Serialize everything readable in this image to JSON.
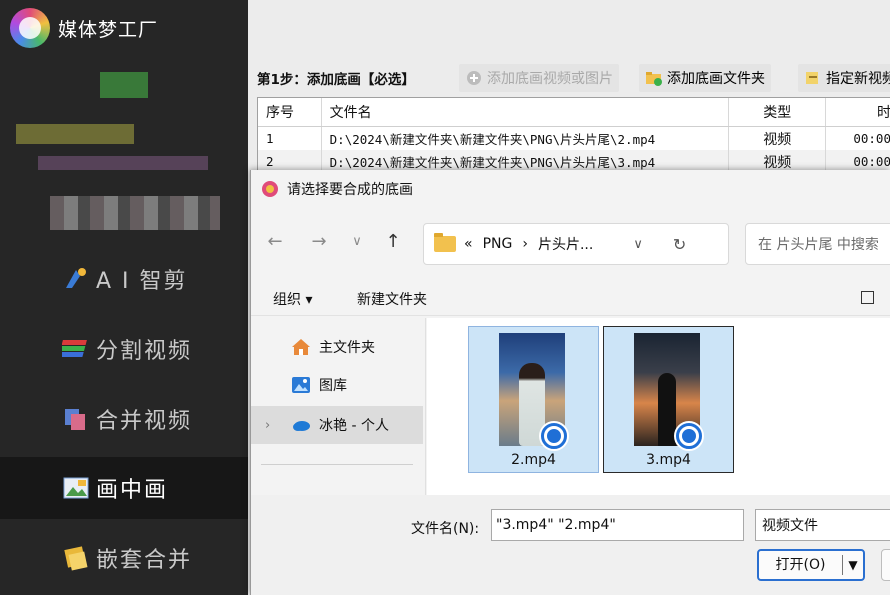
{
  "app": {
    "title": "媒体梦工厂"
  },
  "sidebar": {
    "items": [
      {
        "label": "A I 智剪",
        "icon": "ai-cut-icon"
      },
      {
        "label": "分割视频",
        "icon": "split-video-icon"
      },
      {
        "label": "合并视频",
        "icon": "merge-video-icon"
      },
      {
        "label": "画中画",
        "icon": "picture-in-picture-icon",
        "active": true
      },
      {
        "label": "嵌套合并",
        "icon": "nested-merge-icon"
      }
    ]
  },
  "toolbar": {
    "step_label": "第1步：添加底画【必选】",
    "add_video_or_image": "添加底画视频或图片",
    "add_folder": "添加底画文件夹",
    "specify_new": "指定新视频"
  },
  "table": {
    "headers": [
      "序号",
      "文件名",
      "类型",
      "时"
    ],
    "rows": [
      {
        "index": "1",
        "filename": "D:\\2024\\新建文件夹\\新建文件夹\\PNG\\片头片尾\\2.mp4",
        "type": "视频",
        "time": "00:00"
      },
      {
        "index": "2",
        "filename": "D:\\2024\\新建文件夹\\新建文件夹\\PNG\\片头片尾\\3.mp4",
        "type": "视频",
        "time": "00:00"
      }
    ]
  },
  "dialog": {
    "title": "请选择要合成的底画",
    "address": {
      "prefix": "«",
      "segments": [
        "PNG",
        "›",
        "片头片..."
      ]
    },
    "search_placeholder": "在 片头片尾 中搜索",
    "commands": {
      "organize": "组织 ▾",
      "new_folder": "新建文件夹"
    },
    "nav_items": [
      {
        "label": "主文件夹",
        "icon": "home-icon"
      },
      {
        "label": "图库",
        "icon": "gallery-icon"
      },
      {
        "label": "冰艳 - 个人",
        "icon": "cloud-icon",
        "selected": true
      }
    ],
    "files": [
      {
        "name": "2.mp4",
        "selected": true
      },
      {
        "name": "3.mp4",
        "selected": true,
        "focused": true
      }
    ],
    "filename_label": "文件名(N):",
    "filename_value": "\"3.mp4\" \"2.mp4\"",
    "filetype_value": "视频文件",
    "open_button": "打开(O)"
  }
}
